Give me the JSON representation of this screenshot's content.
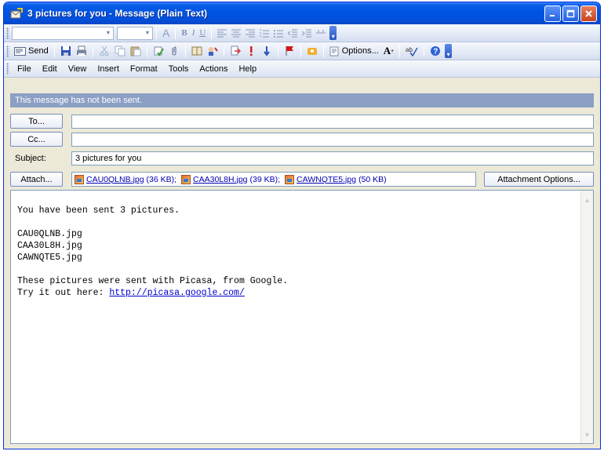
{
  "window": {
    "title": "3 pictures for you - Message (Plain Text)"
  },
  "format_toolbar": {
    "bold_label": "B",
    "italic_label": "I",
    "underline_label": "U",
    "font_color_label": "A"
  },
  "standard_toolbar": {
    "send_label": "Send",
    "options_label": "Options...",
    "font_size_label": "A"
  },
  "menu": {
    "items": [
      "File",
      "Edit",
      "View",
      "Insert",
      "Format",
      "Tools",
      "Actions",
      "Help"
    ]
  },
  "infobar": {
    "text": "This message has not been sent."
  },
  "fields": {
    "to_label": "To...",
    "to_value": "",
    "cc_label": "Cc...",
    "cc_value": "",
    "subject_label": "Subject:",
    "subject_value": "3 pictures for you",
    "attach_label": "Attach...",
    "attachment_options_label": "Attachment Options..."
  },
  "attachments": [
    {
      "name": "CAU0QLNB.jpg",
      "size": "(36 KB);"
    },
    {
      "name": "CAA30L8H.jpg",
      "size": "(39 KB);"
    },
    {
      "name": "CAWNQTE5.jpg",
      "size": "(50 KB)"
    }
  ],
  "message": {
    "line1": "You have been sent 3 pictures.",
    "file1": "CAU0QLNB.jpg",
    "file2": "CAA30L8H.jpg",
    "file3": "CAWNQTE5.jpg",
    "line2": "These pictures were sent with Picasa, from Google.",
    "line3_prefix": "Try it out here: ",
    "link": "http://picasa.google.com/"
  },
  "colors": {
    "titlebar": "#0054e3",
    "infobar": "#8c9fc4",
    "link": "#0000cc"
  }
}
